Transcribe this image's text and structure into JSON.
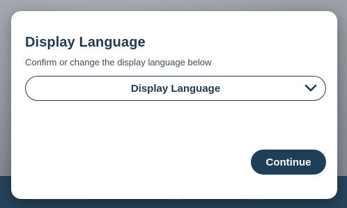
{
  "modal": {
    "title": "Display Language",
    "subtitle": "Confirm or change the display language below",
    "language_select": {
      "selected_value": "Display Language",
      "icon": "chevron-down-icon"
    },
    "continue_label": "Continue"
  },
  "colors": {
    "primary": "#1f3a52",
    "button_bg": "#1f3f58",
    "modal_bg": "#ffffff",
    "backdrop": "#8f969c"
  }
}
